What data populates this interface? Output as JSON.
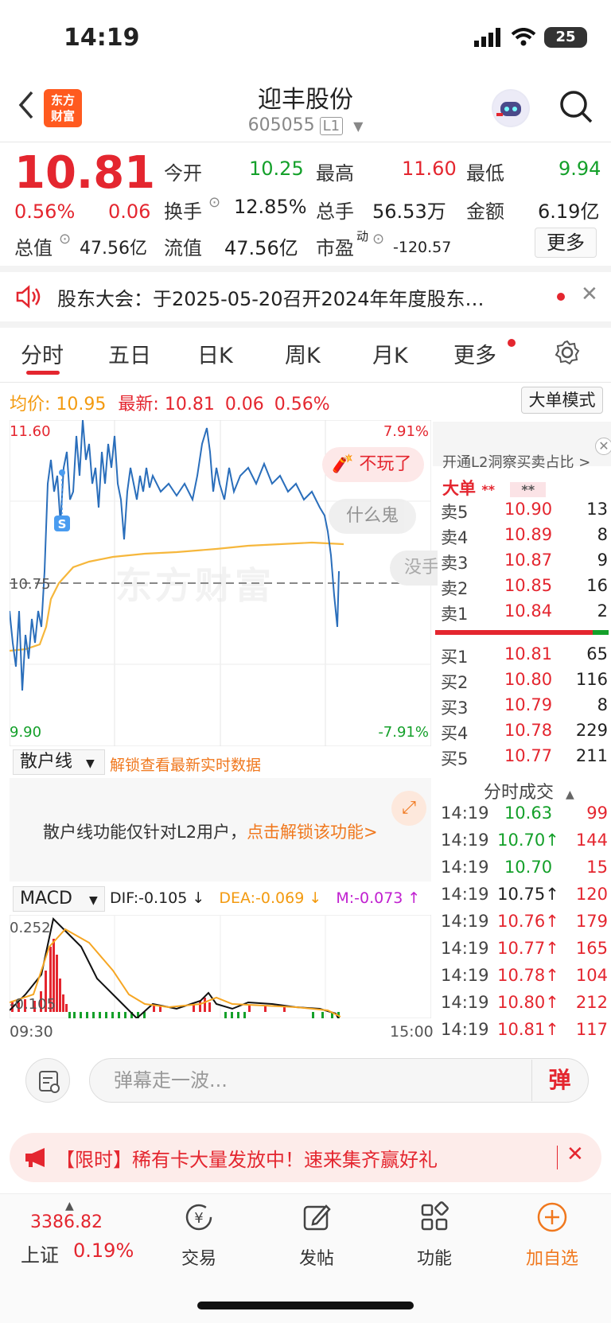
{
  "status": {
    "time": "14:19",
    "battery": "25"
  },
  "header": {
    "title": "迎丰股份",
    "code": "605055",
    "level": "L1",
    "logo_line1": "东方",
    "logo_line2": "财富"
  },
  "quote": {
    "price": "10.81",
    "change_pct": "0.56%",
    "change": "0.06",
    "open_label": "今开",
    "open": "10.25",
    "high_label": "最高",
    "high": "11.60",
    "low_label": "最低",
    "low": "9.94",
    "turnover_label": "换手",
    "turnover": "12.85%",
    "volume_label": "总手",
    "volume": "56.53万",
    "amount_label": "金额",
    "amount": "6.19亿",
    "total_cap_label": "总值",
    "total_cap": "47.56亿",
    "float_cap_label": "流值",
    "float_cap": "47.56亿",
    "pe_label": "市盈",
    "pe_sup": "动",
    "pe": "-120.57",
    "more": "更多"
  },
  "notice": {
    "text": "股东大会：于2025-05-20召开2024年年度股东…"
  },
  "tabs": [
    "分时",
    "五日",
    "日K",
    "周K",
    "月K",
    "更多"
  ],
  "infobar": {
    "avg_label": "均价:",
    "avg": "10.95",
    "latest_label": "最新:",
    "latest": "10.81",
    "chg": "0.06",
    "pct": "0.56%",
    "big_mode": "大单模式"
  },
  "main_chart": {
    "y_top": "11.60",
    "y_mid": "10.75",
    "y_bottom": "9.90",
    "pct_top": "7.91%",
    "pct_bottom": "-7.91%",
    "marker": "S",
    "watermark": "东方财富"
  },
  "danmaku": [
    "不玩了",
    "什么鬼",
    "没手"
  ],
  "retail": {
    "select": "散户线",
    "unlock": "解锁查看最新实时数据",
    "msg": "散户线功能仅针对L2用户，",
    "msg_link": "点击解锁该功能>"
  },
  "macd": {
    "select": "MACD",
    "dif": "DIF:-0.105 ↓",
    "dea": "DEA:-0.069 ↓",
    "m": "M:-0.073 ↑",
    "y_top": "0.252",
    "y_bottom": "-0.105",
    "time_start": "09:30",
    "time_end": "15:00"
  },
  "orderbook": {
    "l2_text": "开通L2洞察买卖占比 >",
    "big_label": "大单",
    "big_stars1": "**",
    "big_stars2": "**",
    "asks": [
      {
        "label": "卖5",
        "price": "10.90",
        "vol": "13"
      },
      {
        "label": "卖4",
        "price": "10.89",
        "vol": "8"
      },
      {
        "label": "卖3",
        "price": "10.87",
        "vol": "9"
      },
      {
        "label": "卖2",
        "price": "10.85",
        "vol": "16"
      },
      {
        "label": "卖1",
        "price": "10.84",
        "vol": "2"
      }
    ],
    "bids": [
      {
        "label": "买1",
        "price": "10.81",
        "vol": "65"
      },
      {
        "label": "买2",
        "price": "10.80",
        "vol": "116"
      },
      {
        "label": "买3",
        "price": "10.79",
        "vol": "8"
      },
      {
        "label": "买4",
        "price": "10.78",
        "vol": "229"
      },
      {
        "label": "买5",
        "price": "10.77",
        "vol": "211"
      }
    ]
  },
  "trades": {
    "title": "分时成交",
    "rows": [
      {
        "time": "14:19",
        "price": "10.63",
        "vol": "99",
        "pc": "green",
        "vc": "red"
      },
      {
        "time": "14:19",
        "price": "10.70↑",
        "vol": "144",
        "pc": "green",
        "vc": "red"
      },
      {
        "time": "14:19",
        "price": "10.70",
        "vol": "15",
        "pc": "green",
        "vc": "red"
      },
      {
        "time": "14:19",
        "price": "10.75↑",
        "vol": "120",
        "pc": "black",
        "vc": "red"
      },
      {
        "time": "14:19",
        "price": "10.76↑",
        "vol": "179",
        "pc": "red",
        "vc": "red"
      },
      {
        "time": "14:19",
        "price": "10.77↑",
        "vol": "165",
        "pc": "red",
        "vc": "red"
      },
      {
        "time": "14:19",
        "price": "10.78↑",
        "vol": "104",
        "pc": "red",
        "vc": "red"
      },
      {
        "time": "14:19",
        "price": "10.80↑",
        "vol": "212",
        "pc": "red",
        "vc": "red"
      },
      {
        "time": "14:19",
        "price": "10.81↑",
        "vol": "117",
        "pc": "red",
        "vc": "red"
      }
    ]
  },
  "chat": {
    "placeholder": "弹幕走一波...",
    "send": "弹"
  },
  "promo": {
    "text": "【限时】稀有卡大量发放中！速来集齐赢好礼"
  },
  "nav": {
    "index_value": "3386.82",
    "index_name": "上证",
    "index_pct": "0.19%",
    "items": [
      "交易",
      "发帖",
      "功能",
      "加自选"
    ]
  }
}
